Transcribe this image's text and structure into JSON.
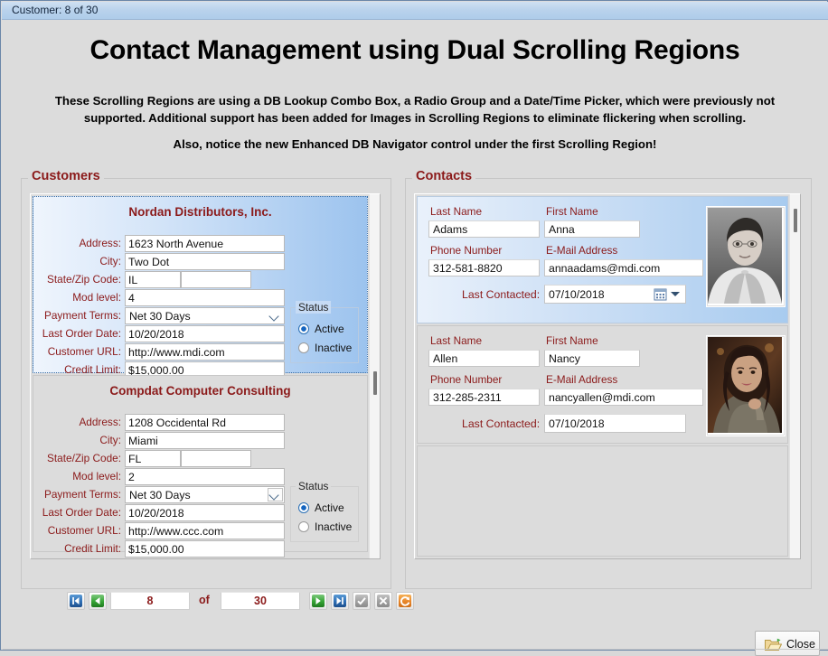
{
  "window": {
    "titlebar_text": "Customer: 8 of 30",
    "page_title": "Contact Management using Dual Scrolling Regions",
    "description_line1": "These Scrolling Regions are using a DB Lookup Combo Box, a Radio Group and a Date/Time Picker, which were previously not supported.  Additional support has been added for Images in Scrolling Regions to eliminate flickering when scrolling.",
    "description_line2": "Also, notice the new Enhanced DB Navigator control under the first Scrolling Region!"
  },
  "colors": {
    "label_red": "#8b1a1a",
    "panel_blue": "#9cc3ee",
    "window_bg": "#dcdcdc",
    "titlebar_blue": "#b9d2ec"
  },
  "customers": {
    "group_label": "Customers",
    "field_labels": {
      "address": "Address:",
      "city": "City:",
      "state_zip": "State/Zip Code:",
      "mod_level": "Mod level:",
      "payment_terms": "Payment Terms:",
      "last_order_date": "Last Order Date:",
      "customer_url": "Customer URL:",
      "credit_limit": "Credit Limit:"
    },
    "status_group": {
      "label": "Status",
      "options": [
        "Active",
        "Inactive"
      ]
    },
    "records": [
      {
        "name": "Nordan Distributors, Inc.",
        "selected": true,
        "address": "1623 North Avenue",
        "city": "Two Dot",
        "state": "IL",
        "zip": "",
        "mod_level": "4",
        "payment_terms": "Net 30 Days",
        "last_order_date": "10/20/2018",
        "customer_url": "http://www.mdi.com",
        "credit_limit": "$15,000.00",
        "status": "Active"
      },
      {
        "name": "Compdat Computer Consulting",
        "selected": false,
        "address": "1208 Occidental Rd",
        "city": "Miami",
        "state": "FL",
        "zip": "",
        "mod_level": "2",
        "payment_terms": "Net 30 Days",
        "last_order_date": "10/20/2018",
        "customer_url": "http://www.ccc.com",
        "credit_limit": "$15,000.00",
        "status": "Active"
      }
    ]
  },
  "navigator": {
    "current_record": "8",
    "of_label": "of",
    "total_records": "30",
    "buttons": [
      {
        "name": "first-record",
        "icon": "first-icon",
        "color": "blue",
        "enabled": true
      },
      {
        "name": "prior-record",
        "icon": "prior-icon",
        "color": "green",
        "enabled": true
      },
      {
        "name": "next-record",
        "icon": "next-icon",
        "color": "green",
        "enabled": true
      },
      {
        "name": "last-record",
        "icon": "last-icon",
        "color": "blue",
        "enabled": true
      },
      {
        "name": "post-record",
        "icon": "check-icon",
        "color": "gray",
        "enabled": false
      },
      {
        "name": "cancel-record",
        "icon": "cancel-x-icon",
        "color": "gray",
        "enabled": false
      },
      {
        "name": "refresh-record",
        "icon": "refresh-icon",
        "color": "orange",
        "enabled": true
      }
    ]
  },
  "contacts": {
    "group_label": "Contacts",
    "field_labels": {
      "last_name": "Last Name",
      "first_name": "First Name",
      "phone": "Phone Number",
      "email": "E-Mail Address",
      "last_contacted": "Last Contacted:"
    },
    "records": [
      {
        "selected": true,
        "last_name": "Adams",
        "first_name": "Anna",
        "phone": "312-581-8820",
        "email": "annaadams@mdi.com",
        "last_contacted": "07/10/2018",
        "has_date_picker": true,
        "photo": "portrait-woman-grayscale"
      },
      {
        "selected": false,
        "last_name": "Allen",
        "first_name": "Nancy",
        "phone": "312-285-2311",
        "email": "nancyallen@mdi.com",
        "last_contacted": "07/10/2018",
        "has_date_picker": false,
        "photo": "portrait-woman-color"
      }
    ]
  },
  "footer": {
    "close_label_prefix": "C",
    "close_label_rest": "lose",
    "close_icon": "open-folder-icon"
  }
}
